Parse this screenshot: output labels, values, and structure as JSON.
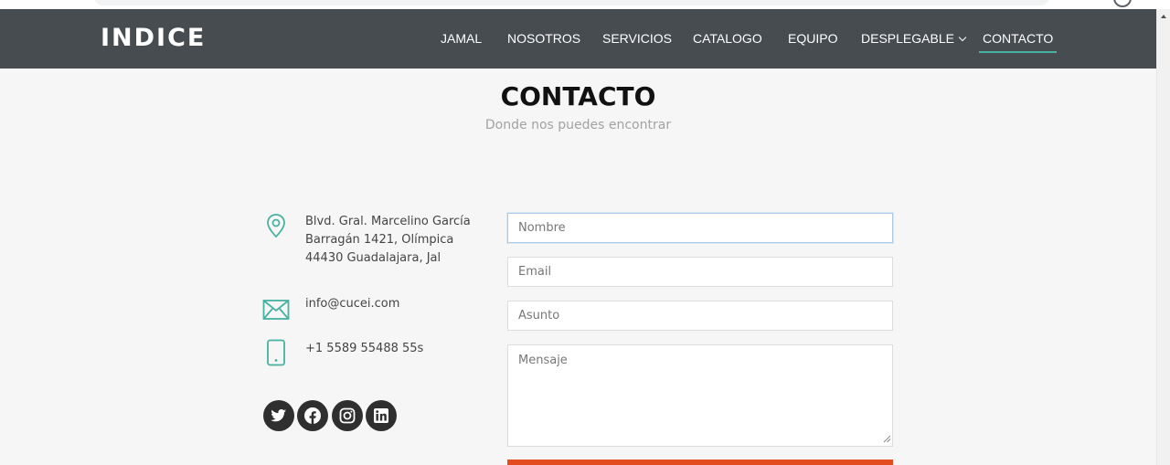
{
  "header": {
    "logo": "INDICE",
    "nav": [
      {
        "label": "JAMAL"
      },
      {
        "label": "NOSOTROS"
      },
      {
        "label": "SERVICIOS"
      },
      {
        "label": "CATALOGO"
      },
      {
        "label": "EQUIPO"
      },
      {
        "label": "DESPLEGABLE",
        "has_dropdown": true
      },
      {
        "label": "CONTACTO",
        "active": true
      }
    ]
  },
  "section": {
    "title": "CONTACTO",
    "subtitle": "Donde nos puedes encontrar"
  },
  "contact_info": {
    "address_lines": [
      "Blvd. Gral. Marcelino García",
      "Barragán 1421, Olímpica",
      "44430 Guadalajara, Jal"
    ],
    "email": "info@cucei.com",
    "phone": "+1 5589 55488 55s",
    "icons": [
      "map-pin-icon",
      "envelope-icon",
      "phone-icon"
    ]
  },
  "social": [
    {
      "icon": "twitter-icon"
    },
    {
      "icon": "facebook-icon"
    },
    {
      "icon": "instagram-icon"
    },
    {
      "icon": "linkedin-icon"
    }
  ],
  "form": {
    "name_placeholder": "Nombre",
    "email_placeholder": "Email",
    "subject_placeholder": "Asunto",
    "message_placeholder": "Mensaje"
  },
  "colors": {
    "header_bg": "#474c51",
    "accent": "#47b2a0",
    "submit": "#e24c1f",
    "page_bg": "#f6f6f6"
  }
}
